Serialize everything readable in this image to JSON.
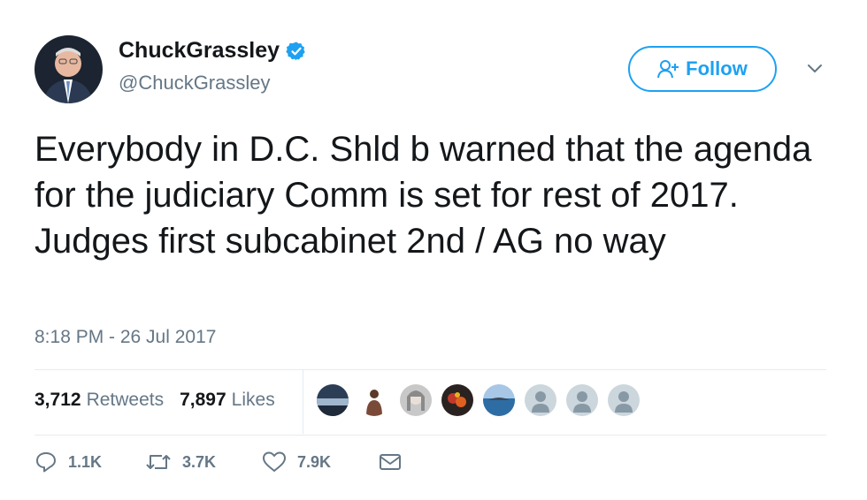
{
  "author": {
    "display_name": "ChuckGrassley",
    "handle": "@ChuckGrassley",
    "verified_icon": "verified-badge-icon",
    "avatar_icon": "profile-photo"
  },
  "follow_button": {
    "label": "Follow",
    "icon": "add-user-icon"
  },
  "menu_icon": "chevron-down-icon",
  "tweet": {
    "text": "Everybody in D.C. Shld b warned that the agenda for the judiciary Comm is set for rest of 2017. Judges first subcabinet 2nd / AG no way",
    "timestamp": "8:18 PM - 26 Jul 2017"
  },
  "stats": {
    "retweets_count": "3,712",
    "retweets_label": "Retweets",
    "likes_count": "7,897",
    "likes_label": "Likes"
  },
  "likers": [
    "liker-avatar-landscape",
    "liker-avatar-person",
    "liker-avatar-woman",
    "liker-avatar-flowers",
    "liker-avatar-sea",
    "liker-avatar-default",
    "liker-avatar-default",
    "liker-avatar-default"
  ],
  "actions": {
    "reply_count": "1.1K",
    "retweet_count": "3.7K",
    "like_count": "7.9K"
  },
  "colors": {
    "accent": "#1da1f2",
    "secondary_text": "#657786",
    "primary_text": "#14171a",
    "divider": "#e6ecf0"
  }
}
